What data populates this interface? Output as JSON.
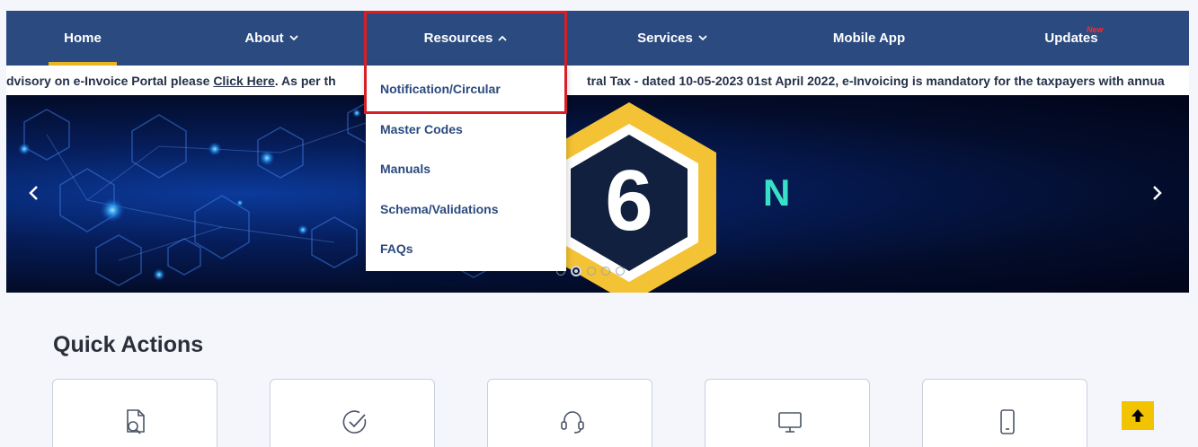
{
  "nav": {
    "home": "Home",
    "about": "About",
    "resources": "Resources",
    "services": "Services",
    "mobile_app": "Mobile App",
    "updates": "Updates",
    "new_badge": "New"
  },
  "marquee": {
    "left_text": "dvisory on e-Invoice Portal please ",
    "link_text": "Click Here",
    "middle_text": ". As per th",
    "right_text": "tral Tax - dated 10-05-2023 01st April 2022, e-Invoicing is mandatory for the taxpayers with annua"
  },
  "resources_menu": [
    "Notification/Circular",
    "Master Codes",
    "Manuals",
    "Schema/Validations",
    "FAQs"
  ],
  "banner": {
    "digit": "6",
    "letter": "N",
    "arrow_left": "‹",
    "arrow_right": "›",
    "slide_count": 5,
    "active_slide": 2
  },
  "quick_actions": {
    "title": "Quick Actions",
    "cards": [
      {
        "icon": "document-search-icon"
      },
      {
        "icon": "check-circle-icon"
      },
      {
        "icon": "headset-icon"
      },
      {
        "icon": "desktop-icon"
      },
      {
        "icon": "mobile-icon"
      }
    ]
  },
  "colors": {
    "nav_bg": "#2b4a7f",
    "accent": "#e9b522",
    "highlight": "#d61f26",
    "scroll_top": "#f2c400"
  }
}
